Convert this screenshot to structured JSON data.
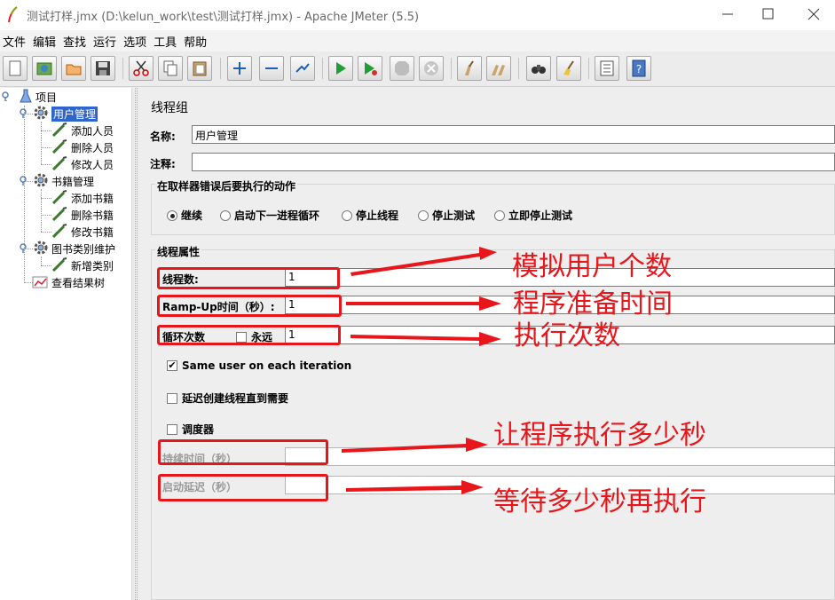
{
  "window": {
    "title": "测试打样.jmx (D:\\kelun_work\\test\\测试打样.jmx) - Apache JMeter (5.5)"
  },
  "menu": [
    "文件",
    "编辑",
    "查找",
    "运行",
    "选项",
    "工具",
    "帮助"
  ],
  "toolbar": [
    "new",
    "templates",
    "open",
    "save",
    "cut",
    "copy",
    "paste",
    "expand",
    "collapse",
    "toggle",
    "start",
    "start-no-pauses",
    "stop",
    "shutdown",
    "clear",
    "clear-all",
    "search",
    "reset-search",
    "function-helper",
    "help"
  ],
  "tree": {
    "root": "项目",
    "groups": [
      {
        "label": "用户管理",
        "children": [
          "添加人员",
          "删除人员",
          "修改人员"
        ]
      },
      {
        "label": "书籍管理",
        "children": [
          "添加书籍",
          "删除书籍",
          "修改书籍"
        ]
      },
      {
        "label": "图书类别维护",
        "children": [
          "新增类别"
        ]
      }
    ],
    "listener": "查看结果树"
  },
  "panel": {
    "title": "线程组",
    "name_label": "名称:",
    "name_value": "用户管理",
    "comment_label": "注释:",
    "comment_value": "",
    "error_action": {
      "title": "在取样器错误后要执行的动作",
      "options": [
        "继续",
        "启动下一进程循环",
        "停止线程",
        "停止测试",
        "立即停止测试"
      ],
      "selected": "继续"
    },
    "thread_props": {
      "title": "线程属性",
      "threads_label": "线程数:",
      "threads_value": "1",
      "rampup_label": "Ramp-Up时间（秒）:",
      "rampup_value": "1",
      "loop_label": "循环次数",
      "forever_label": "永远",
      "forever_checked": false,
      "loop_value": "1",
      "same_user_label": "Same user on each iteration",
      "same_user_checked": true,
      "delay_label": "延迟创建线程直到需要",
      "delay_checked": false,
      "scheduler_label": "调度器",
      "scheduler_checked": false,
      "duration_label": "持续时间（秒）",
      "duration_value": "",
      "startup_delay_label": "启动延迟（秒）",
      "startup_delay_value": ""
    }
  },
  "annotations": {
    "color": "#e8161b",
    "threads": "模拟用户个数",
    "rampup": "程序准备时间",
    "loops": "执行次数",
    "duration": "让程序执行多少秒",
    "delay": "等待多少秒再执行"
  }
}
